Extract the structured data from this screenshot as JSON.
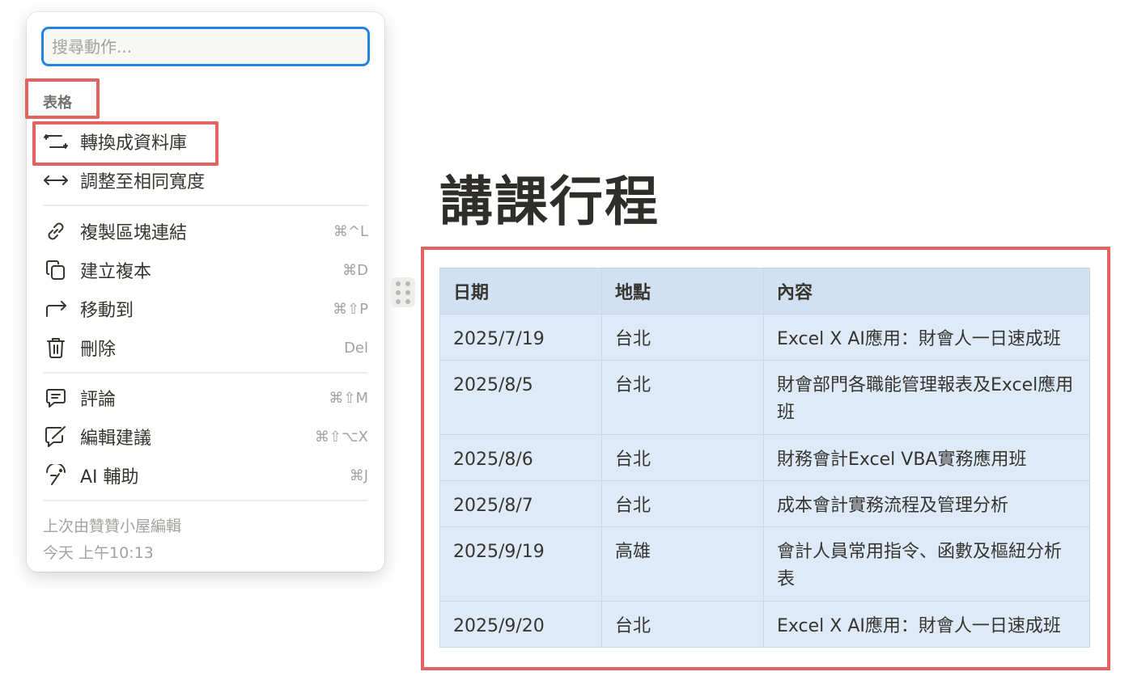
{
  "menu": {
    "search": {
      "placeholder": "搜尋動作..."
    },
    "section_label": "表格",
    "items": [
      {
        "label": "轉換成資料庫",
        "icon": "convert-icon",
        "shortcut": ""
      },
      {
        "label": "調整至相同寬度",
        "icon": "arrows-horizontal-icon",
        "shortcut": ""
      },
      {
        "label": "複製區塊連結",
        "icon": "link-icon",
        "shortcut": "⌘^L"
      },
      {
        "label": "建立複本",
        "icon": "duplicate-icon",
        "shortcut": "⌘D"
      },
      {
        "label": "移動到",
        "icon": "move-arrow-icon",
        "shortcut": "⌘⇧P"
      },
      {
        "label": "刪除",
        "icon": "trash-icon",
        "shortcut": "Del"
      },
      {
        "label": "評論",
        "icon": "comment-icon",
        "shortcut": "⌘⇧M"
      },
      {
        "label": "編輯建議",
        "icon": "suggest-edit-icon",
        "shortcut": "⌘⇧⌥X"
      },
      {
        "label": "AI 輔助",
        "icon": "ai-icon",
        "shortcut": "⌘J"
      }
    ],
    "last_edited_by": "上次由贊贊小屋編輯",
    "last_edited_time": "今天 上午10:13"
  },
  "page": {
    "title": "講課行程"
  },
  "table": {
    "headers": [
      "日期",
      "地點",
      "內容"
    ],
    "rows": [
      [
        "2025/7/19",
        "台北",
        "Excel X AI應用：財會人一日速成班"
      ],
      [
        "2025/8/5",
        "台北",
        "財會部門各職能管理報表及Excel應用班"
      ],
      [
        "2025/8/6",
        "台北",
        "財務會計Excel VBA實務應用班"
      ],
      [
        "2025/8/7",
        "台北",
        "成本會計實務流程及管理分析"
      ],
      [
        "2025/9/19",
        "高雄",
        "會計人員常用指令、函數及樞紐分析表"
      ],
      [
        "2025/9/20",
        "台北",
        "Excel X AI應用：財會人一日速成班"
      ]
    ]
  },
  "colors": {
    "accent": "#2383e2",
    "highlight": "#e3645f",
    "table_bg": "#deeaf8",
    "header_bg": "#d2e1f2"
  }
}
